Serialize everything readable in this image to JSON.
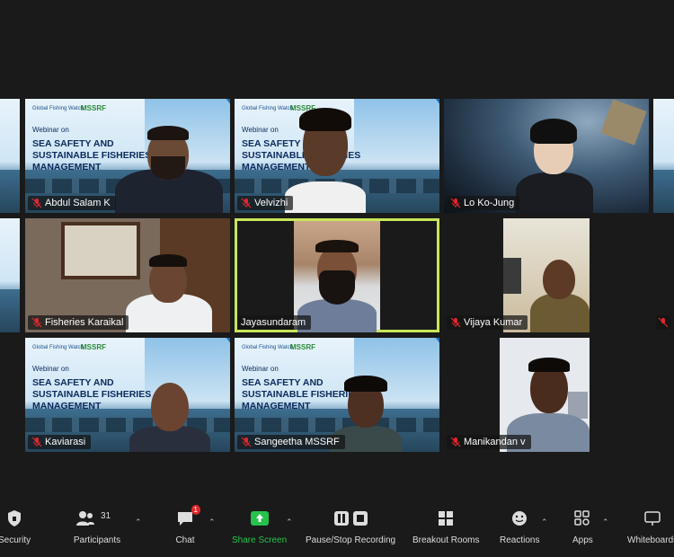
{
  "slide": {
    "org_logo": "Global Fishing Watch",
    "partner_logo": "MSSRF",
    "subtitle": "Webinar on",
    "title_lines": [
      "SEA SAFETY AND",
      "SUSTAINABLE FISHERIES",
      "MANAGEMENT"
    ]
  },
  "participants_grid": [
    {
      "name": "Abdul Salam K",
      "muted": true
    },
    {
      "name": "Velvizhi",
      "muted": true
    },
    {
      "name": "Lo Ko-Jung",
      "muted": true
    },
    {
      "name": "Fisheries Karaikal",
      "muted": true
    },
    {
      "name": "Jayasundaram",
      "muted": false,
      "active_speaker": true
    },
    {
      "name": "Vijaya Kumar",
      "muted": true
    },
    {
      "name": "Kaviarasi",
      "muted": true
    },
    {
      "name": "Sangeetha MSSRF",
      "muted": true
    },
    {
      "name": "Manikandan v",
      "muted": true
    }
  ],
  "toolbar": {
    "security": "Security",
    "participants": "Participants",
    "participants_count": "31",
    "chat": "Chat",
    "chat_badge": "1",
    "share_screen": "Share Screen",
    "pause_recording": "Pause/Stop Recording",
    "breakout_rooms": "Breakout Rooms",
    "reactions": "Reactions",
    "apps": "Apps",
    "whiteboards": "Whiteboards"
  },
  "colors": {
    "active_speaker_border": "#c8e65a",
    "share_screen_green": "#27c24c",
    "muted_red": "#e0272d",
    "slide_title": "#0b2a5c"
  }
}
